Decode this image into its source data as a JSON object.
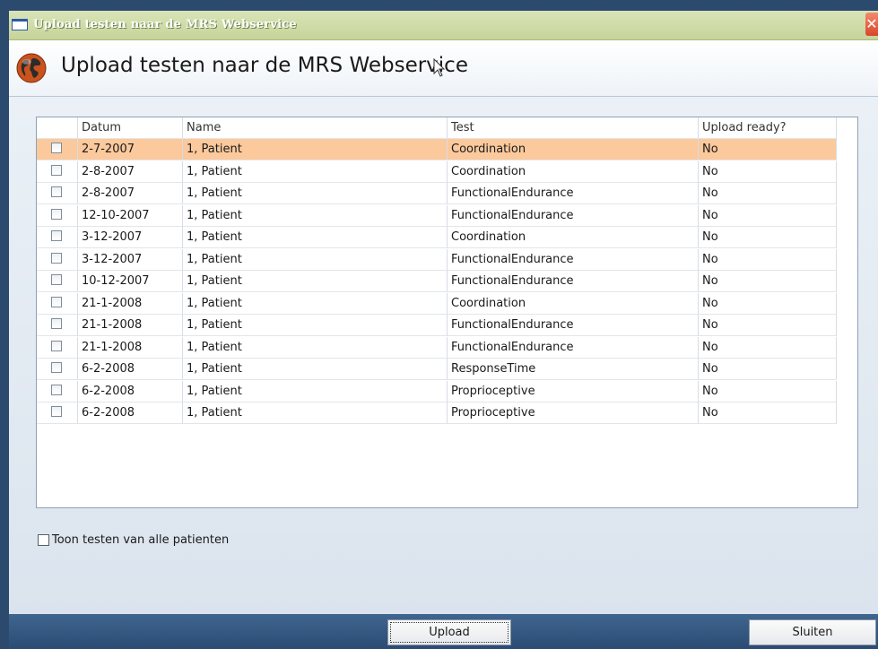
{
  "window": {
    "title": "Upload testen naar de MRS Webservice",
    "close_glyph": "✕"
  },
  "header": {
    "title": "Upload testen naar de MRS Webservice",
    "icon": "globe-icon"
  },
  "grid": {
    "columns": [
      "",
      "Datum",
      "Name",
      "Test",
      "Upload ready?"
    ],
    "rows": [
      {
        "datum": "2-7-2007",
        "name": "1, Patient",
        "test": "Coordination",
        "ready": "No",
        "selected": true
      },
      {
        "datum": "2-8-2007",
        "name": "1, Patient",
        "test": "Coordination",
        "ready": "No"
      },
      {
        "datum": "2-8-2007",
        "name": "1, Patient",
        "test": "FunctionalEndurance",
        "ready": "No"
      },
      {
        "datum": "12-10-2007",
        "name": "1, Patient",
        "test": "FunctionalEndurance",
        "ready": "No"
      },
      {
        "datum": "3-12-2007",
        "name": "1, Patient",
        "test": "Coordination",
        "ready": "No"
      },
      {
        "datum": "3-12-2007",
        "name": "1, Patient",
        "test": "FunctionalEndurance",
        "ready": "No"
      },
      {
        "datum": "10-12-2007",
        "name": "1, Patient",
        "test": "FunctionalEndurance",
        "ready": "No"
      },
      {
        "datum": "21-1-2008",
        "name": "1, Patient",
        "test": "Coordination",
        "ready": "No"
      },
      {
        "datum": "21-1-2008",
        "name": "1, Patient",
        "test": "FunctionalEndurance",
        "ready": "No"
      },
      {
        "datum": "21-1-2008",
        "name": "1, Patient",
        "test": "FunctionalEndurance",
        "ready": "No"
      },
      {
        "datum": "6-2-2008",
        "name": "1, Patient",
        "test": "ResponseTime",
        "ready": "No"
      },
      {
        "datum": "6-2-2008",
        "name": "1, Patient",
        "test": "Proprioceptive",
        "ready": "No"
      },
      {
        "datum": "6-2-2008",
        "name": "1, Patient",
        "test": "Proprioceptive",
        "ready": "No"
      }
    ]
  },
  "show_all_label": "Toon testen van alle patienten",
  "footer": {
    "upload_label": "Upload",
    "close_label": "Sluiten"
  },
  "colors": {
    "selected_row": "#fbc99c",
    "footer": "#2a4b73",
    "titlebar": "#c6d49a"
  }
}
